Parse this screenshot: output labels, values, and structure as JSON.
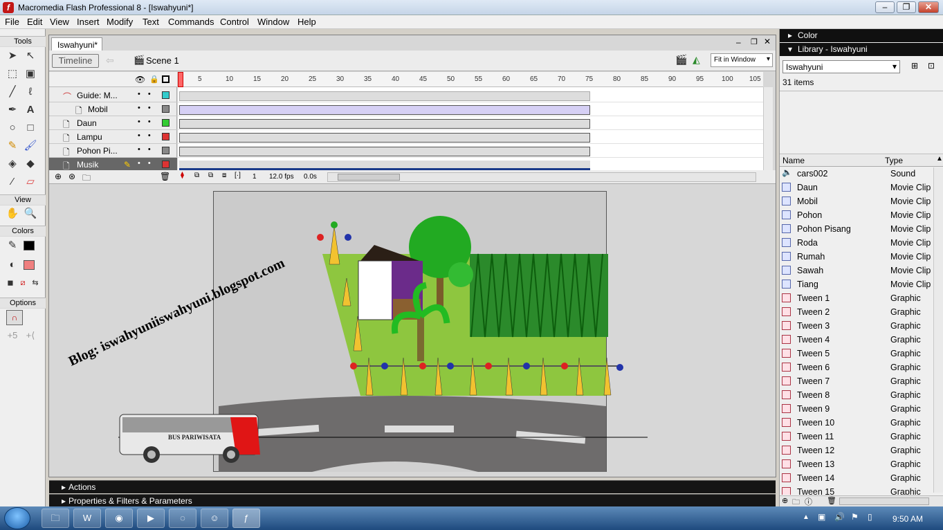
{
  "window": {
    "title": "Macromedia Flash Professional 8 - [Iswahyuni*]"
  },
  "menu": [
    "File",
    "Edit",
    "View",
    "Insert",
    "Modify",
    "Text",
    "Commands",
    "Control",
    "Window",
    "Help"
  ],
  "tools": {
    "header": "Tools",
    "view_header": "View",
    "colors_header": "Colors",
    "options_header": "Options"
  },
  "document": {
    "tab": "Iswahyuni*",
    "timeline_button": "Timeline",
    "scene": "Scene 1",
    "zoom": "Fit in Window"
  },
  "timeline": {
    "ruler": [
      "5",
      "10",
      "15",
      "20",
      "25",
      "30",
      "35",
      "40",
      "45",
      "50",
      "55",
      "60",
      "65",
      "70",
      "75",
      "80",
      "85",
      "90",
      "95",
      "100",
      "105"
    ],
    "layers": [
      {
        "name": "Guide: M...",
        "color": "#33cccc"
      },
      {
        "name": "Mobil",
        "color": "#888888"
      },
      {
        "name": "Daun",
        "color": "#33cc33"
      },
      {
        "name": "Lampu",
        "color": "#dd3333"
      },
      {
        "name": "Pohon Pi...",
        "color": "#888888"
      },
      {
        "name": "Musik",
        "color": "#dd3333"
      }
    ],
    "current_frame": "1",
    "fps": "12.0 fps",
    "time": "0.0s"
  },
  "stage": {
    "blog_text": "Blog: iswahyuniiswahyuni.blogspot.com",
    "bus_label": "BUS PARIWISATA"
  },
  "panels": {
    "actions": "Actions",
    "properties": "Properties & Filters & Parameters"
  },
  "right": {
    "color_header": "Color",
    "library_header": "Library - Iswahyuni",
    "library_select": "Iswahyuni",
    "count": "31 items",
    "col_name": "Name",
    "col_type": "Type",
    "items": [
      {
        "name": "cars002",
        "type": "Sound",
        "icon": "sound-icon"
      },
      {
        "name": "Daun",
        "type": "Movie Clip",
        "icon": "movieclip-icon"
      },
      {
        "name": "Mobil",
        "type": "Movie Clip",
        "icon": "movieclip-icon"
      },
      {
        "name": "Pohon",
        "type": "Movie Clip",
        "icon": "movieclip-icon"
      },
      {
        "name": "Pohon Pisang",
        "type": "Movie Clip",
        "icon": "movieclip-icon"
      },
      {
        "name": "Roda",
        "type": "Movie Clip",
        "icon": "movieclip-icon"
      },
      {
        "name": "Rumah",
        "type": "Movie Clip",
        "icon": "movieclip-icon"
      },
      {
        "name": "Sawah",
        "type": "Movie Clip",
        "icon": "movieclip-icon"
      },
      {
        "name": "Tiang",
        "type": "Movie Clip",
        "icon": "movieclip-icon"
      },
      {
        "name": "Tween 1",
        "type": "Graphic",
        "icon": "graphic-icon"
      },
      {
        "name": "Tween 2",
        "type": "Graphic",
        "icon": "graphic-icon"
      },
      {
        "name": "Tween 3",
        "type": "Graphic",
        "icon": "graphic-icon"
      },
      {
        "name": "Tween 4",
        "type": "Graphic",
        "icon": "graphic-icon"
      },
      {
        "name": "Tween 5",
        "type": "Graphic",
        "icon": "graphic-icon"
      },
      {
        "name": "Tween 6",
        "type": "Graphic",
        "icon": "graphic-icon"
      },
      {
        "name": "Tween 7",
        "type": "Graphic",
        "icon": "graphic-icon"
      },
      {
        "name": "Tween 8",
        "type": "Graphic",
        "icon": "graphic-icon"
      },
      {
        "name": "Tween 9",
        "type": "Graphic",
        "icon": "graphic-icon"
      },
      {
        "name": "Tween 10",
        "type": "Graphic",
        "icon": "graphic-icon"
      },
      {
        "name": "Tween 11",
        "type": "Graphic",
        "icon": "graphic-icon"
      },
      {
        "name": "Tween 12",
        "type": "Graphic",
        "icon": "graphic-icon"
      },
      {
        "name": "Tween 13",
        "type": "Graphic",
        "icon": "graphic-icon"
      },
      {
        "name": "Tween 14",
        "type": "Graphic",
        "icon": "graphic-icon"
      },
      {
        "name": "Tween 15",
        "type": "Graphic",
        "icon": "graphic-icon"
      }
    ]
  },
  "taskbar": {
    "clock": "9:50 AM"
  }
}
